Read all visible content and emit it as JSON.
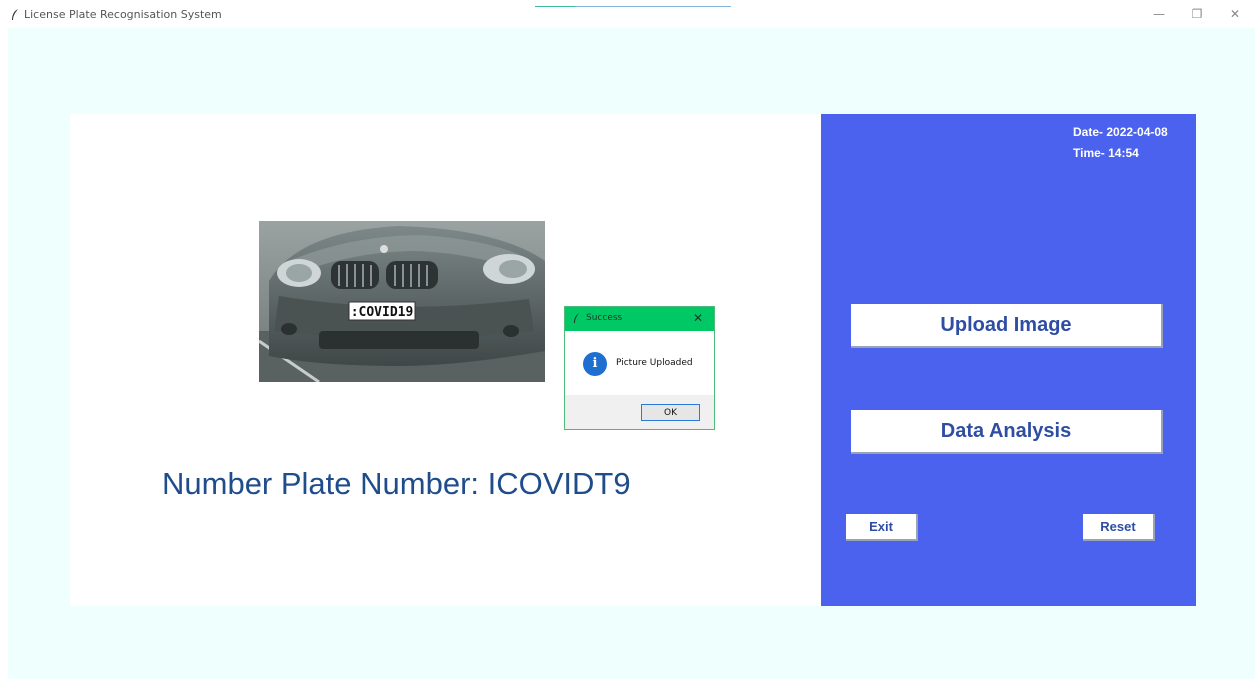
{
  "window": {
    "title": "License Plate Recognisation System",
    "controls": {
      "minimize": "—",
      "maximize": "❐",
      "close": "✕"
    }
  },
  "colors": {
    "client_background": "#effffe",
    "panel_white": "#ffffff",
    "panel_blue": "#4a62ee",
    "button_text": "#2f4ea3",
    "plate_text": "#1f4d8c",
    "dialog_titlebar": "#00c864"
  },
  "left_panel": {
    "plate_label": "Number Plate Number: ICOVIDT9",
    "car_photo": {
      "plate_text": ":COVID19"
    }
  },
  "right_panel": {
    "date": "Date- 2022-04-08",
    "time": "Time- 14:54",
    "buttons": {
      "upload": "Upload Image",
      "analysis": "Data Analysis",
      "exit": "Exit",
      "reset": "Reset"
    }
  },
  "dialog": {
    "title": "Success",
    "icon": "info-icon",
    "message": "Picture Uploaded",
    "ok_label": "OK",
    "close": "✕"
  }
}
